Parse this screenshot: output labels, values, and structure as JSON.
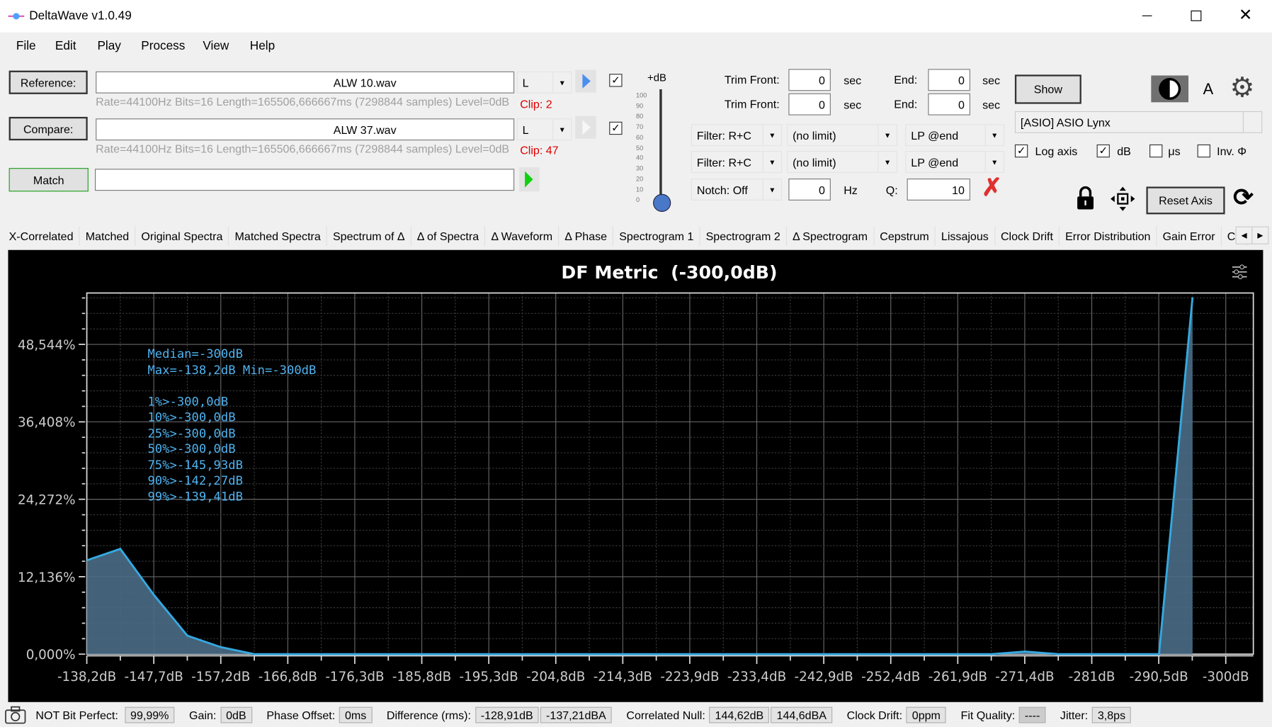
{
  "window": {
    "title": "DeltaWave v1.0.49"
  },
  "menu": [
    "File",
    "Edit",
    "Play",
    "Process",
    "View",
    "Help"
  ],
  "reference": {
    "button": "Reference:",
    "file": "ALW 10.wav",
    "info": "Rate=44100Hz Bits=16 Length=165506,666667ms (7298844 samples) Level=0dB",
    "channel": "L",
    "clip": "Clip: 2",
    "checked": true
  },
  "compare": {
    "button": "Compare:",
    "file": "ALW 37.wav",
    "info": "Rate=44100Hz Bits=16 Length=165506,666667ms (7298844 samples) Level=0dB",
    "channel": "L",
    "clip": "Clip: 47",
    "checked": true
  },
  "match": {
    "button": "Match",
    "value": ""
  },
  "gain_slider": {
    "label": "+dB",
    "ticks": [
      "100",
      "90",
      "80",
      "70",
      "60",
      "50",
      "40",
      "30",
      "20",
      "10",
      "0"
    ],
    "value": 0
  },
  "trim": [
    {
      "front_label": "Trim Front:",
      "front": "0",
      "unit": "sec",
      "end_label": "End:",
      "end": "0"
    },
    {
      "front_label": "Trim Front:",
      "front": "0",
      "unit": "sec",
      "end_label": "End:",
      "end": "0"
    }
  ],
  "filters": [
    {
      "filter": "Filter: R+C",
      "limit": "(no limit)",
      "lp": "LP @end"
    },
    {
      "filter": "Filter: R+C",
      "limit": "(no limit)",
      "lp": "LP @end"
    }
  ],
  "notch": {
    "mode": "Notch: Off",
    "freq": "0",
    "unit": "Hz",
    "q_label": "Q:",
    "q": "10"
  },
  "right_panel": {
    "show": "Show",
    "font_label": "A",
    "device": "[ASIO] ASIO Lynx",
    "reset_axis": "Reset Axis",
    "options": [
      {
        "label": "Log axis",
        "checked": true
      },
      {
        "label": "dB",
        "checked": true
      },
      {
        "label": "μs",
        "checked": false
      },
      {
        "label": "Inv. Φ",
        "checked": false
      }
    ]
  },
  "tabs": [
    "X-Correlated",
    "Matched",
    "Original Spectra",
    "Matched Spectra",
    "Spectrum of Δ",
    "Δ of Spectra",
    "Δ Waveform",
    "Δ Phase",
    "Spectrogram 1",
    "Spectrogram 2",
    "Δ Spectrogram",
    "Cepstrum",
    "Lissajous",
    "Clock Drift",
    "Error Distribution",
    "Gain Error",
    "Cc"
  ],
  "chart_data": {
    "type": "area",
    "title": "DF Metric  (-300,0dB)",
    "x_tick_labels": [
      "-138,2dB",
      "-147,7dB",
      "-157,2dB",
      "-166,8dB",
      "-176,3dB",
      "-185,8dB",
      "-195,3dB",
      "-204,8dB",
      "-214,3dB",
      "-223,9dB",
      "-233,4dB",
      "-242,9dB",
      "-252,4dB",
      "-261,9dB",
      "-271,4dB",
      "-281dB",
      "-290,5dB",
      "-300dB"
    ],
    "y_tick_labels": [
      "0,000%",
      "12,136%",
      "24,272%",
      "36,408%",
      "48,544%"
    ],
    "xlim": [
      -138.2,
      -300
    ],
    "ylim": [
      0,
      56.6
    ],
    "grid": true,
    "x": [
      -138.2,
      -142.96,
      -147.72,
      -152.48,
      -157.24,
      -162.0,
      -166.76,
      -171.52,
      -176.28,
      -181.04,
      -185.8,
      -190.56,
      -195.32,
      -200.08,
      -204.84,
      -209.6,
      -214.36,
      -219.12,
      -223.88,
      -228.64,
      -233.4,
      -238.16,
      -242.92,
      -247.68,
      -252.44,
      -257.2,
      -261.96,
      -266.72,
      -271.48,
      -276.24,
      -281.0,
      -285.76,
      -290.52,
      -295.28
    ],
    "y": [
      14.7,
      16.5,
      9.3,
      2.9,
      1.1,
      0,
      0,
      0,
      0,
      0,
      0,
      0,
      0,
      0,
      0,
      0,
      0,
      0,
      0,
      0,
      0,
      0,
      0,
      0,
      0,
      0,
      0,
      0,
      0.4,
      0,
      0,
      0,
      0,
      55.9
    ],
    "line_color": "#35a9e0",
    "fill_color": "#4a6d87",
    "annotations": [
      "Median=-300dB",
      "Max=-138,2dB Min=-300dB",
      "",
      "1%>-300,0dB",
      "10%>-300,0dB",
      "25%>-300,0dB",
      "50%>-300,0dB",
      "75%>-145,93dB",
      "90%>-142,27dB",
      "99%>-139,41dB"
    ]
  },
  "status": {
    "bit_perfect_label": "NOT Bit Perfect:",
    "bit_perfect": "99,99%",
    "gain_label": "Gain:",
    "gain": "0dB",
    "phase_label": "Phase Offset:",
    "phase": "0ms",
    "diff_label": "Difference (rms):",
    "diff_db": "-128,91dB",
    "diff_dba": "-137,21dBA",
    "null_label": "Correlated Null:",
    "null_db": "144,62dB",
    "null_dba": "144,6dBA",
    "drift_label": "Clock Drift:",
    "drift": "0ppm",
    "fit_label": "Fit Quality:",
    "fit": "----",
    "jitter_label": "Jitter:",
    "jitter": "3,8ps"
  }
}
